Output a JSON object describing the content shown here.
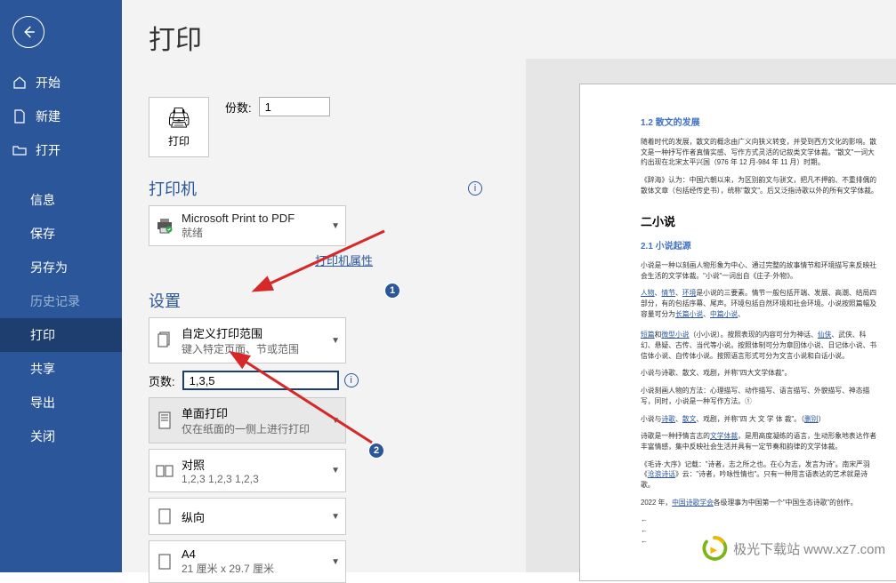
{
  "sidebar": {
    "items": [
      {
        "label": "开始"
      },
      {
        "label": "新建"
      },
      {
        "label": "打开"
      },
      {
        "label": "信息"
      },
      {
        "label": "保存"
      },
      {
        "label": "另存为"
      },
      {
        "label": "历史记录"
      },
      {
        "label": "打印"
      },
      {
        "label": "共享"
      },
      {
        "label": "导出"
      },
      {
        "label": "关闭"
      }
    ]
  },
  "title": "打印",
  "print_button": "打印",
  "copies": {
    "label": "份数:",
    "value": "1"
  },
  "printer": {
    "section": "打印机",
    "name": "Microsoft Print to PDF",
    "status": "就绪",
    "properties": "打印机属性"
  },
  "settings": {
    "section": "设置",
    "range": {
      "line1": "自定义打印范围",
      "line2": "键入特定页面、节或范围"
    },
    "pages": {
      "label": "页数:",
      "value": "1,3,5"
    },
    "side": {
      "line1": "单面打印",
      "line2": "仅在纸面的一侧上进行打印"
    },
    "collate": {
      "line1": "对照",
      "line2": "1,2,3    1,2,3    1,2,3"
    },
    "orient": {
      "line1": "纵向"
    },
    "paper": {
      "line1": "A4",
      "line2": "21 厘米 x 29.7 厘米"
    }
  },
  "preview": {
    "h12": "1.2 散文的发展",
    "p1": "随着时代的发展，散文的概念由广义向狭义转变，并受到西方文化的影响。散文是一种抒写作者真情实感、写作方式灵活的记叙类文学体裁。\"散文\"一词大约出现在北宋太平兴国（976 年 12 月-984 年 11 月）时期。",
    "p2": "《辞海》认为：中国六朝以来，为区别韵文与骈文，把凡不押韵、不重排偶的散体文章（包括经传史书），统称\"散文\"。后又泛指诗歌以外的所有文学体裁。",
    "h2": "二小说",
    "h21": "2.1 小说起源",
    "p3": "小说是一种以刻画人物形象为中心、通过完整的故事情节和环境描写来反映社会生活的文学体裁。\"小说\"一词出自《庄子·外物》。",
    "p4": "人物、情节、环境是小说的三要素。情节一般包括开端、发展、高潮、结局四部分，有的包括序幕、尾声。环境包括自然环境和社会环境。小说按照篇幅及容量可分为长篇小说、中篇小说、",
    "p5": "短篇和微型小说（小小说）。按照表现的内容可分为神话、仙侠、武侠、科幻、悬疑、古传、当代等小说。按照体制可分为章回体小说、日记体小说、书信体小说、自传体小说。按照语言形式可分为文言小说和白话小说。",
    "p6": "小说与诗歌、散文、戏剧，并称\"四大文学体裁\"。",
    "p7": "小说刻画人物的方法：心理描写、动作描写、语言描写、外貌描写、神态描写，同时，小说是一种写作方法。①",
    "p8": "小说与诗歌、散文、戏剧，并称\"四 大 文 学 体 裁\"。（删别）",
    "p9": "诗歌是一种抒情言志的文学体裁，是用高度凝练的语言，生动形象地表达作者丰富情感，集中反映社会生活并具有一定节奏和韵律的文学体裁。",
    "p10": "《毛诗·大序》记载：\"诗者，志之所之也。在心为志，发言为诗\"。南宋严羽《沧浪诗话》云：\"诗者，吟咏性情也\"。只有一种用言语表达的艺术就是诗歌。",
    "p11": "2022 年，中国诗歌学会各级理事为中国第一个\"中国生态诗歌\"的创作。"
  },
  "watermark": "极光下载站 www.xz7.com"
}
